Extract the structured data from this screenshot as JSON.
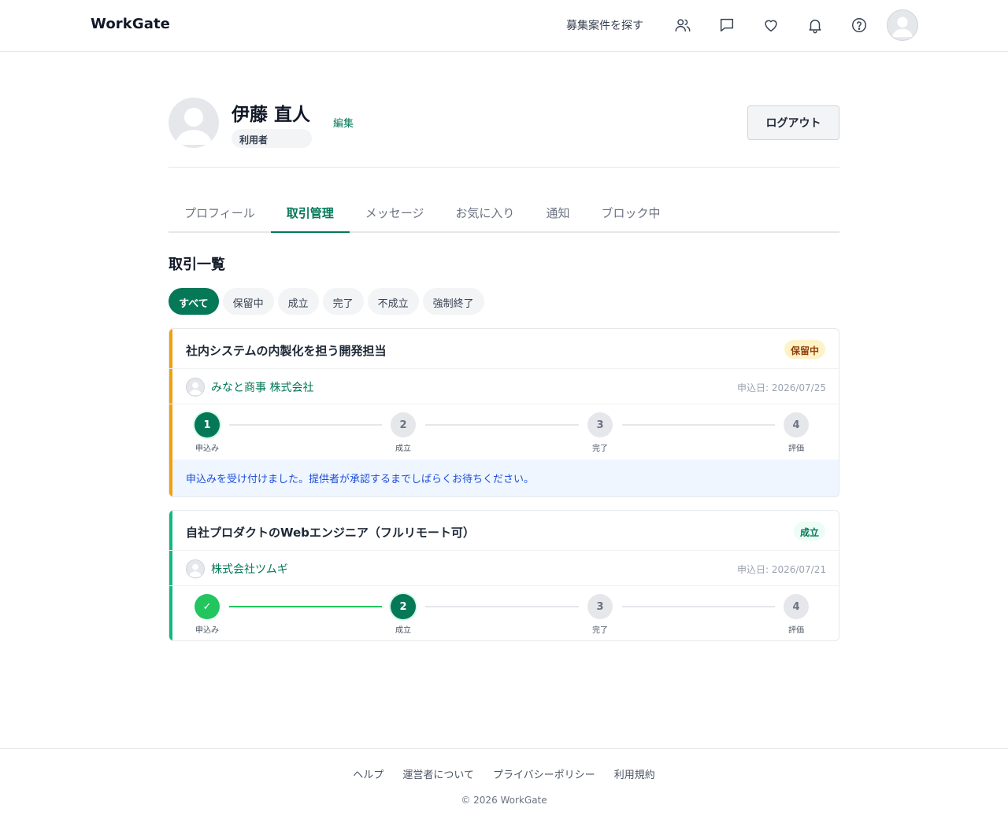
{
  "header": {
    "brand": "WorkGate",
    "nav_link": "募集案件を探す",
    "icons": [
      "users-icon",
      "message-icon",
      "heart-icon",
      "bell-icon",
      "help-icon",
      "avatar"
    ]
  },
  "profile": {
    "name": "伊藤 直人",
    "role": "利用者",
    "edit_label": "編集",
    "logout_label": "ログアウト"
  },
  "tabs": [
    {
      "label": "プロフィール",
      "active": false
    },
    {
      "label": "取引管理",
      "active": true
    },
    {
      "label": "メッセージ",
      "active": false
    },
    {
      "label": "お気に入り",
      "active": false
    },
    {
      "label": "通知",
      "active": false
    },
    {
      "label": "ブロック中",
      "active": false
    }
  ],
  "section_title": "取引一覧",
  "filters": [
    {
      "label": "すべて",
      "active": true
    },
    {
      "label": "保留中",
      "active": false
    },
    {
      "label": "成立",
      "active": false
    },
    {
      "label": "完了",
      "active": false
    },
    {
      "label": "不成立",
      "active": false
    },
    {
      "label": "強制終了",
      "active": false
    }
  ],
  "transactions": [
    {
      "title": "社内システムの内製化を担う開発担当",
      "status": "保留中",
      "status_color": "#92400e",
      "status_bg": "#fef3c7",
      "accent_color": "#f59e0b",
      "company": "みなと商事 株式会社",
      "applied": "申込日: 2026/07/25",
      "steps": [
        {
          "label": "申込み",
          "mark": "1",
          "state": "current"
        },
        {
          "label": "成立",
          "mark": "2",
          "state": "todo"
        },
        {
          "label": "完了",
          "mark": "3",
          "state": "todo"
        },
        {
          "label": "評価",
          "mark": "4",
          "state": "todo"
        }
      ],
      "notice": "申込みを受け付けました。提供者が承認するまでしばらくお待ちください。"
    },
    {
      "title": "自社プロダクトのWebエンジニア（フルリモート可）",
      "status": "成立",
      "status_color": "#047857",
      "status_bg": "#ecfdf5",
      "accent_color": "#10b981",
      "company": "株式会社ツムギ",
      "applied": "申込日: 2026/07/21",
      "steps": [
        {
          "label": "申込み",
          "mark": "✓",
          "state": "done"
        },
        {
          "label": "成立",
          "mark": "2",
          "state": "current"
        },
        {
          "label": "完了",
          "mark": "3",
          "state": "todo"
        },
        {
          "label": "評価",
          "mark": "4",
          "state": "todo"
        }
      ],
      "notice": ""
    }
  ],
  "footer": {
    "links": [
      "ヘルプ",
      "運営者について",
      "プライバシーポリシー",
      "利用規約"
    ],
    "copyright": "© 2026 WorkGate"
  },
  "colors": {
    "brand_green": "#047857",
    "success_green": "#22c55e"
  }
}
